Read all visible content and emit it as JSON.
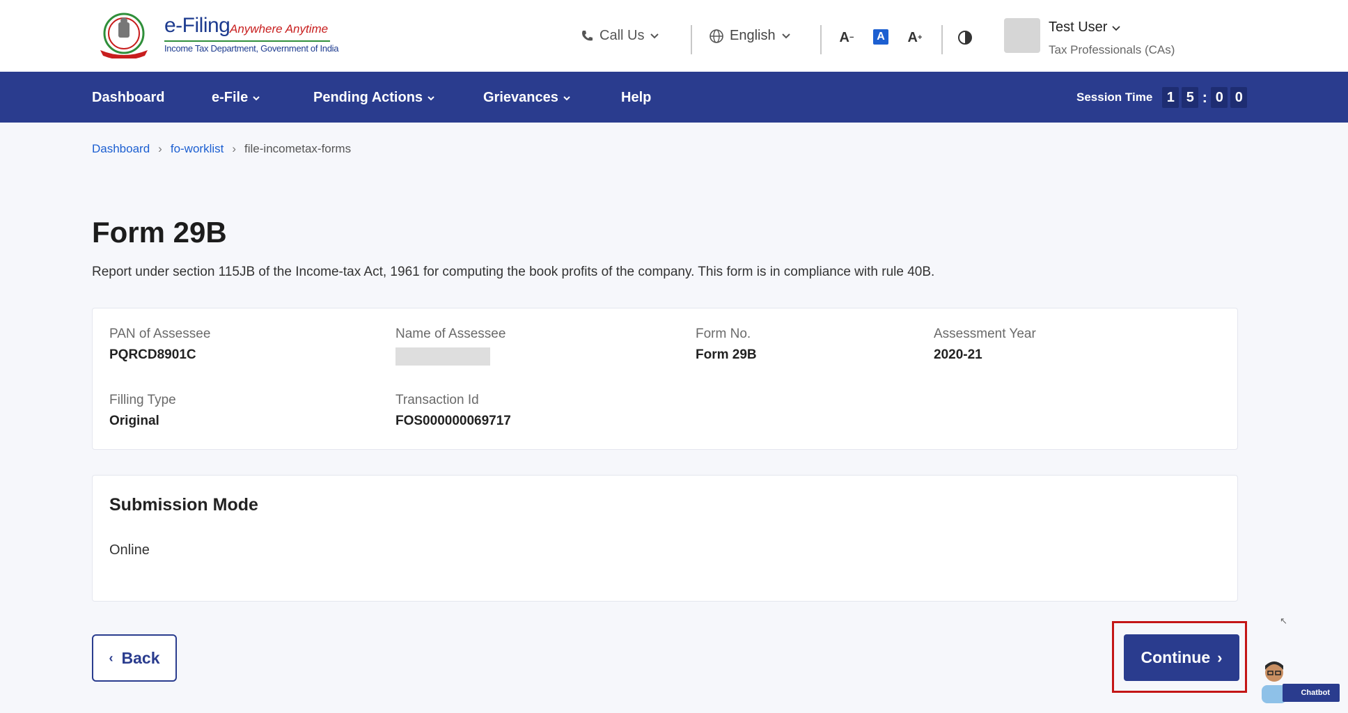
{
  "logo": {
    "title": "e-Filing",
    "tagline": "Anywhere Anytime",
    "subtitle": "Income Tax Department, Government of India"
  },
  "header": {
    "call_us": "Call Us",
    "language": "English",
    "font_decrease": "A",
    "font_reset": "A",
    "font_increase": "A",
    "user_name": "Test User",
    "user_role": "Tax Professionals (CAs)"
  },
  "nav": {
    "items": [
      {
        "label": "Dashboard"
      },
      {
        "label": "e-File"
      },
      {
        "label": "Pending Actions"
      },
      {
        "label": "Grievances"
      },
      {
        "label": "Help"
      }
    ],
    "session_label": "Session Time",
    "session_digits": [
      "1",
      "5",
      "0",
      "0"
    ]
  },
  "breadcrumb": {
    "items": [
      "Dashboard",
      "fo-worklist"
    ],
    "current": "file-incometax-forms"
  },
  "page": {
    "title": "Form 29B",
    "description": "Report under section 115JB of the Income-tax Act, 1961 for computing the book profits of the company. This form is in compliance with rule 40B."
  },
  "details": {
    "pan_label": "PAN of Assessee",
    "pan_value": "PQRCD8901C",
    "name_label": "Name of Assessee",
    "form_label": "Form No.",
    "form_value": "Form 29B",
    "ay_label": "Assessment Year",
    "ay_value": "2020-21",
    "filing_label": "Filling Type",
    "filing_value": "Original",
    "txn_label": "Transaction Id",
    "txn_value": "FOS000000069717"
  },
  "submission": {
    "title": "Submission Mode",
    "value": "Online"
  },
  "actions": {
    "back": "Back",
    "continue": "Continue"
  },
  "chatbot": {
    "label": "Chatbot"
  },
  "colors": {
    "nav_bg": "#2a3c8e",
    "link": "#1c5fd1",
    "highlight": "#c41616"
  }
}
